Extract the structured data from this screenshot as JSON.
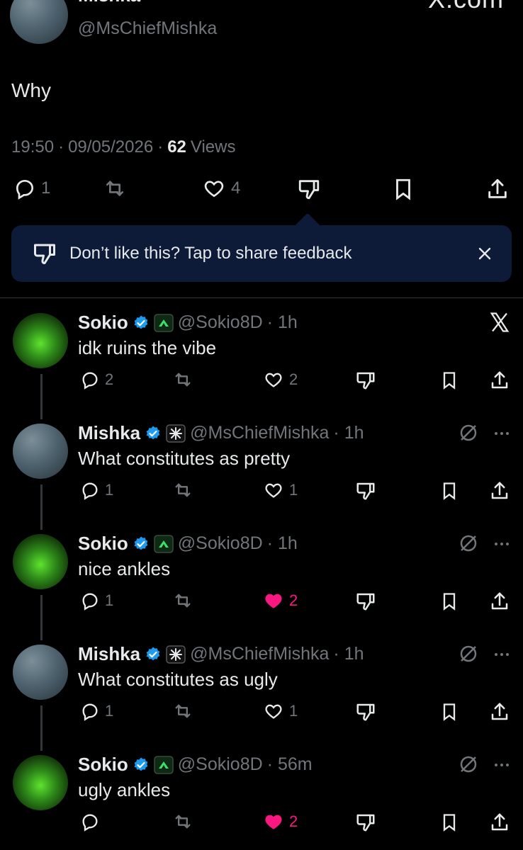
{
  "main_tweet": {
    "display_name_partial": "Mishka",
    "handle": "@MsChiefMishka",
    "watermark": "X.com",
    "text": "Why",
    "time": "19:50",
    "date": "09/05/2026",
    "separator": "·",
    "views_count": "62",
    "views_label": "Views",
    "reply_count": "1",
    "like_count": "4"
  },
  "feedback_banner": {
    "text": "Don’t like this? Tap to share feedback",
    "close_icon": "close-icon"
  },
  "replies": [
    {
      "name": "Sokio",
      "handle": "@Sokio8D",
      "time": "· 1h",
      "text": "idk ruins the vibe",
      "reply_count": "2",
      "like_count": "2",
      "liked": false,
      "avatar": "sokio",
      "badge": "sokio-badge-icon"
    },
    {
      "name": "Mishka",
      "handle": "@MsChiefMishka",
      "time": "· 1h",
      "text": "What constitutes as pretty",
      "reply_count": "1",
      "like_count": "1",
      "liked": false,
      "avatar": "mishka",
      "badge": "mishka-badge-icon"
    },
    {
      "name": "Sokio",
      "handle": "@Sokio8D",
      "time": "· 1h",
      "text": "nice ankles",
      "reply_count": "1",
      "like_count": "2",
      "liked": true,
      "avatar": "sokio",
      "badge": "sokio-badge-icon"
    },
    {
      "name": "Mishka",
      "handle": "@MsChiefMishka",
      "time": "· 1h",
      "text": "What constitutes as ugly",
      "reply_count": "1",
      "like_count": "1",
      "liked": false,
      "avatar": "mishka",
      "badge": "mishka-badge-icon"
    },
    {
      "name": "Sokio",
      "handle": "@Sokio8D",
      "time": "· 56m",
      "text": "ugly ankles",
      "reply_count": "",
      "like_count": "2",
      "liked": true,
      "avatar": "sokio",
      "badge": "sokio-badge-icon"
    }
  ],
  "colors": {
    "background": "#000000",
    "text": "#e7e9ea",
    "secondary": "#71767b",
    "verified": "#1d9bf0",
    "like_active": "#f91880",
    "banner": "#0d1b38"
  }
}
